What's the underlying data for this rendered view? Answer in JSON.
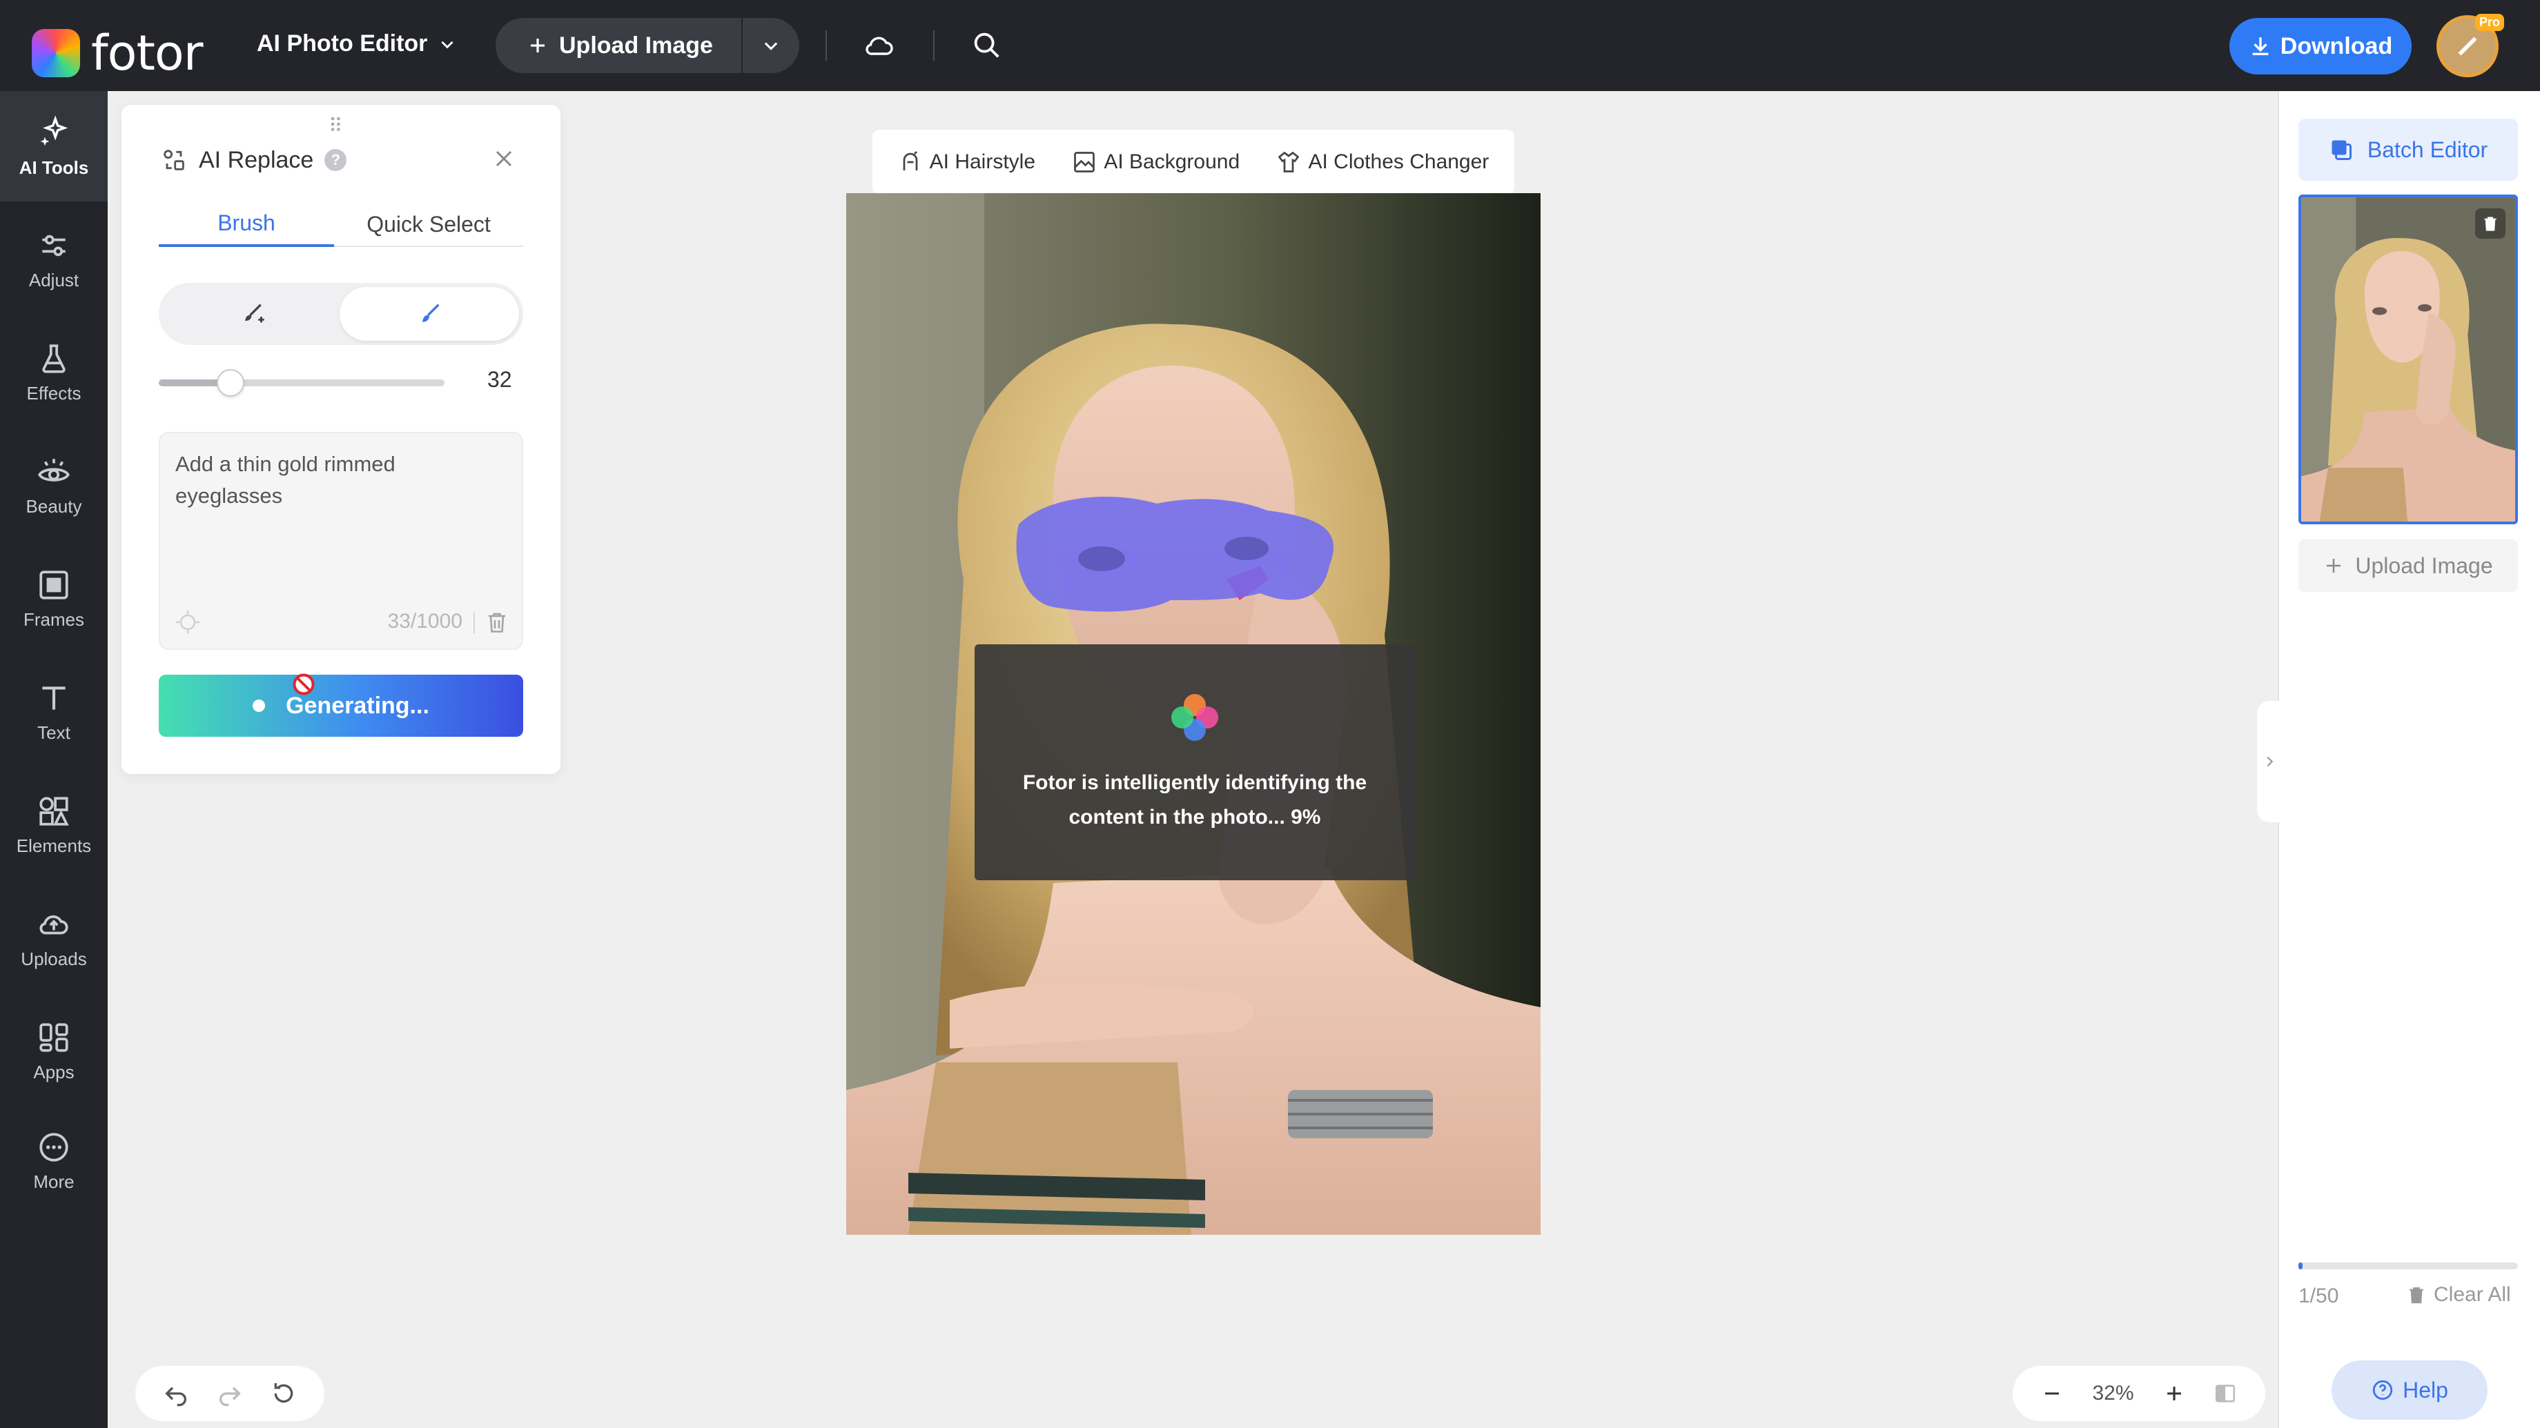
{
  "app": {
    "logo_text": "fotor",
    "menu_label": "AI Photo Editor",
    "upload_label": "Upload Image",
    "download_label": "Download",
    "pro_badge": "Pro"
  },
  "sidebar": {
    "items": [
      {
        "label": "AI Tools",
        "icon": "sparkle-icon"
      },
      {
        "label": "Adjust",
        "icon": "sliders-icon"
      },
      {
        "label": "Effects",
        "icon": "flask-icon"
      },
      {
        "label": "Beauty",
        "icon": "eye-icon"
      },
      {
        "label": "Frames",
        "icon": "frame-icon"
      },
      {
        "label": "Text",
        "icon": "text-icon"
      },
      {
        "label": "Elements",
        "icon": "shapes-icon"
      },
      {
        "label": "Uploads",
        "icon": "cloud-upload-icon"
      },
      {
        "label": "Apps",
        "icon": "apps-icon"
      },
      {
        "label": "More",
        "icon": "more-icon"
      }
    ]
  },
  "panel": {
    "title": "AI Replace",
    "tabs": [
      "Brush",
      "Quick Select"
    ],
    "brush_size": "32",
    "brush_level": 0.25,
    "prompt_text": "Add a thin gold rimmed eyeglasses",
    "char_count": "33/1000",
    "generate_label": "Generating..."
  },
  "features": [
    {
      "label": "AI Hairstyle",
      "icon": "hairstyle-icon"
    },
    {
      "label": "AI Background",
      "icon": "background-icon"
    },
    {
      "label": "AI Clothes Changer",
      "icon": "shirt-icon"
    }
  ],
  "overlay": {
    "text": "Fotor is intelligently identifying the content in the photo... 9%"
  },
  "right": {
    "batch_label": "Batch Editor",
    "upload_label": "Upload Image",
    "page_count": "1/50",
    "progress": 0.02,
    "clear_label": "Clear All",
    "help_label": "Help"
  },
  "zoom": {
    "value": "32%"
  },
  "colors": {
    "accent": "#3b74e8",
    "dark_bg": "#23252b",
    "mask": "#6f6cf0"
  }
}
